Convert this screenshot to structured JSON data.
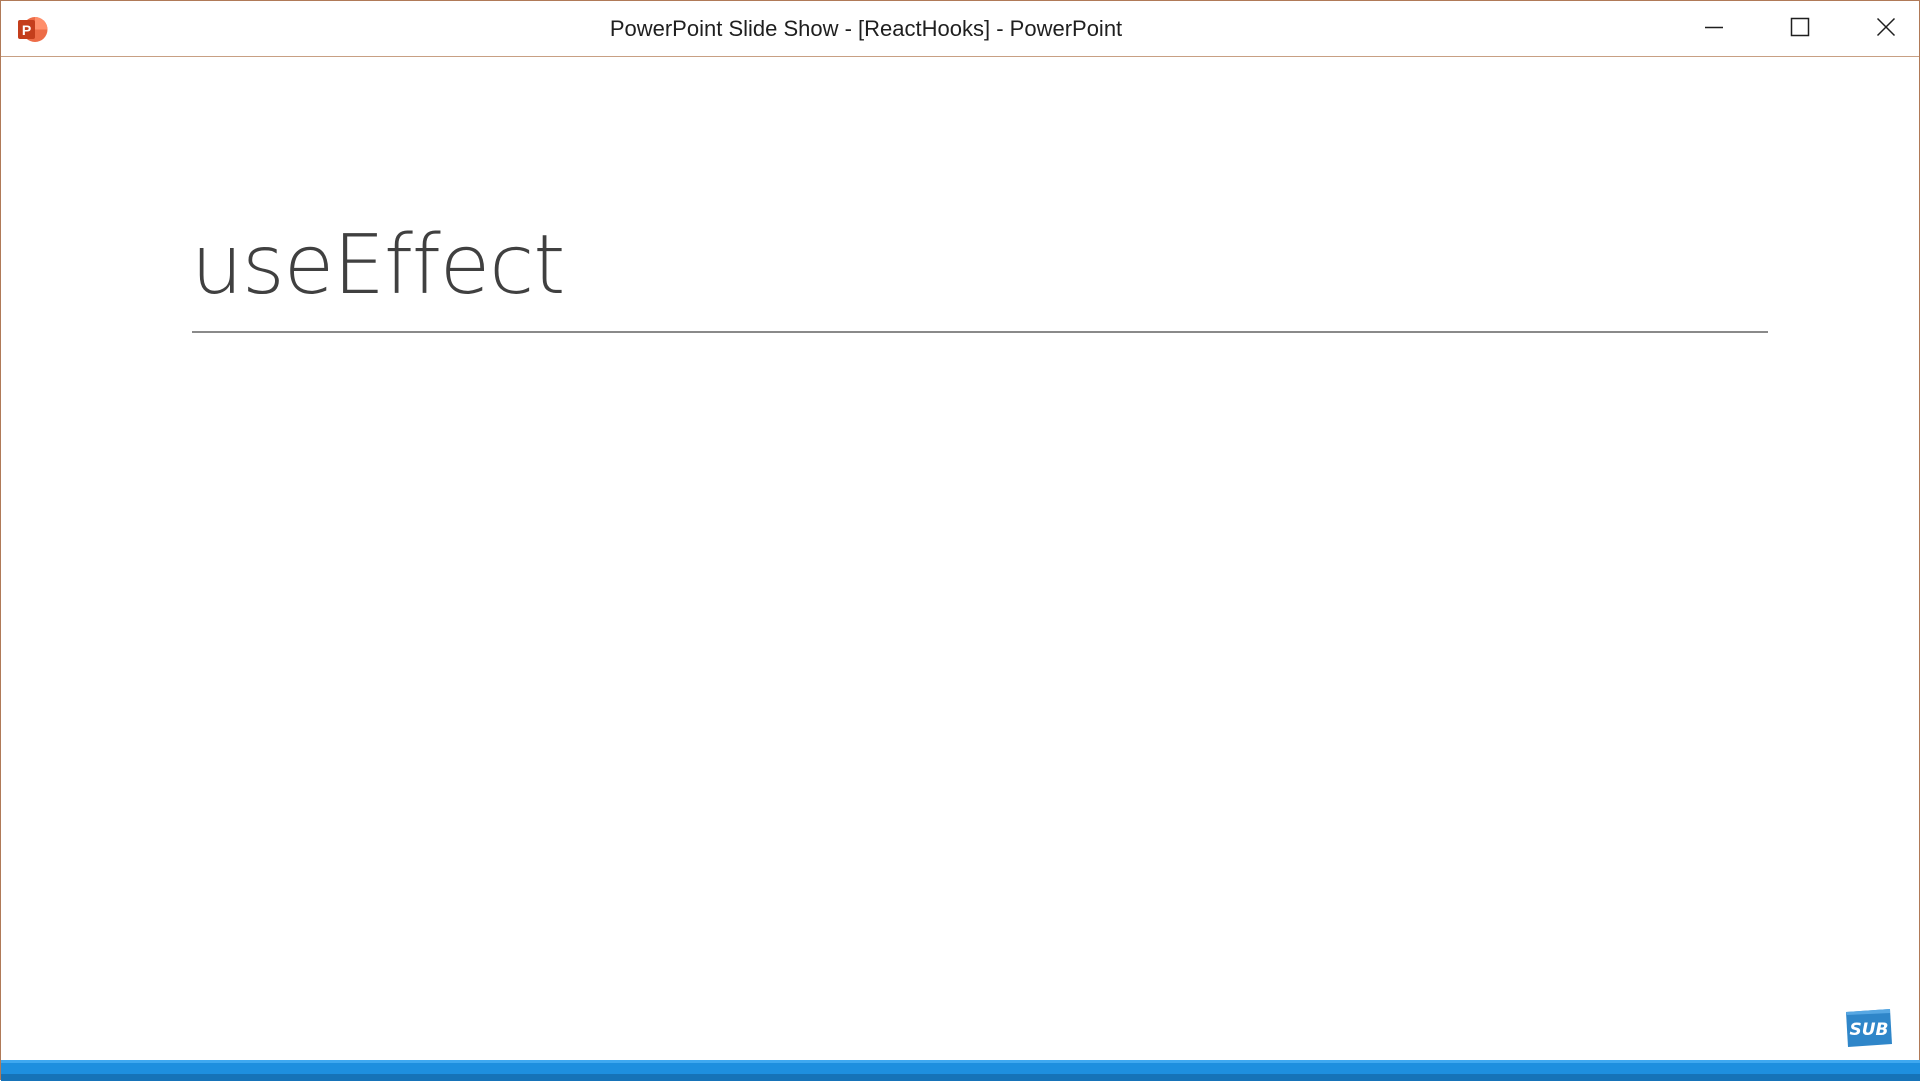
{
  "window": {
    "title": "PowerPoint Slide Show - [ReactHooks] - PowerPoint",
    "app_icon": "powerpoint-icon",
    "controls": {
      "minimize": "minimize-icon",
      "maximize": "maximize-icon",
      "close": "close-icon"
    }
  },
  "slide": {
    "title": "useEffect"
  },
  "overlay": {
    "logo_text": "SUB"
  },
  "colors": {
    "accent_bar": "#1e8fdf",
    "title_text": "#404040",
    "window_border": "#b07a58",
    "powerpoint_orange": "#d24726"
  }
}
